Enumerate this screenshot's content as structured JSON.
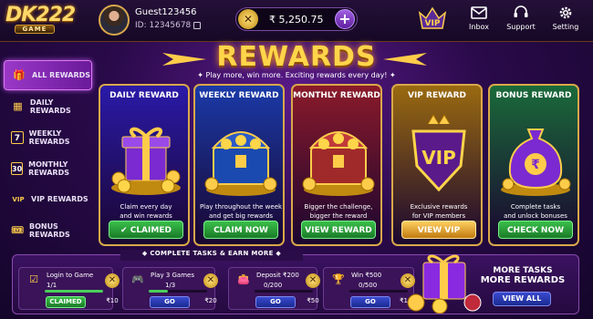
{
  "header": {
    "logo_text": "DK222",
    "logo_sub": "GAME",
    "username": "Guest123456",
    "user_id": "ID: 12345678",
    "balance": "₹ 5,250.75",
    "vip_label": "VIP",
    "nav": [
      {
        "label": "Inbox",
        "icon": "mail-icon"
      },
      {
        "label": "Support",
        "icon": "headset-icon"
      },
      {
        "label": "Setting",
        "icon": "gear-icon"
      }
    ]
  },
  "sidebar": {
    "items": [
      {
        "label": "ALL REWARDS",
        "icon": "gift-icon",
        "active": true
      },
      {
        "label": "DAILY REWARDS",
        "icon": "calendar-icon"
      },
      {
        "label": "WEEKLY REWARDS",
        "icon": "calendar-7-icon"
      },
      {
        "label": "MONTHLY REWARDS",
        "icon": "calendar-30-icon"
      },
      {
        "label": "VIP REWARDS",
        "icon": "vip-icon"
      },
      {
        "label": "BONUS REWARDS",
        "icon": "ticket-icon"
      }
    ]
  },
  "main": {
    "title": "REWARDS",
    "subtitle": "Play more, win more. Exciting rewards every day!",
    "cards": [
      {
        "title": "DAILY REWARD",
        "desc1": "Claim every day",
        "desc2": "and win rewards",
        "button": "✔ CLAIMED",
        "style": "green",
        "bg": "#2a1aa8"
      },
      {
        "title": "WEEKLY REWARD",
        "desc1": "Play throughout the week",
        "desc2": "and get big rewards",
        "button": "CLAIM NOW",
        "style": "green",
        "bg": "#1a3aa8"
      },
      {
        "title": "MONTHLY REWARD",
        "desc1": "Bigger the challenge,",
        "desc2": "bigger the reward",
        "button": "VIEW REWARD",
        "style": "green",
        "bg": "#8a1a2a"
      },
      {
        "title": "VIP REWARD",
        "desc1": "Exclusive rewards",
        "desc2": "for VIP members",
        "button": "VIEW VIP",
        "style": "gold",
        "bg": "#9a6a10"
      },
      {
        "title": "BONUS REWARD",
        "desc1": "Complete tasks",
        "desc2": "and unlock bonuses",
        "button": "CHECK NOW",
        "style": "green",
        "bg": "#1a6a3a"
      }
    ]
  },
  "tasks": {
    "header": "COMPLETE TASKS & EARN MORE",
    "items": [
      {
        "label": "Login to Game",
        "progress": "1/1",
        "fraction": 1.0,
        "button": "CLAIMED",
        "reward": "₹10",
        "icon": "checkbox-icon"
      },
      {
        "label": "Play 3 Games",
        "progress": "1/3",
        "fraction": 0.33,
        "button": "GO",
        "reward": "₹20",
        "icon": "gamepad-icon"
      },
      {
        "label": "Deposit ₹200",
        "progress": "0/200",
        "fraction": 0.0,
        "button": "GO",
        "reward": "₹50",
        "icon": "wallet-icon"
      },
      {
        "label": "Win ₹500",
        "progress": "0/500",
        "fraction": 0.0,
        "button": "GO",
        "reward": "₹100",
        "icon": "trophy-icon"
      }
    ],
    "more_line1": "MORE TASKS",
    "more_line2": "MORE REWARDS",
    "view_all": "VIEW ALL"
  }
}
